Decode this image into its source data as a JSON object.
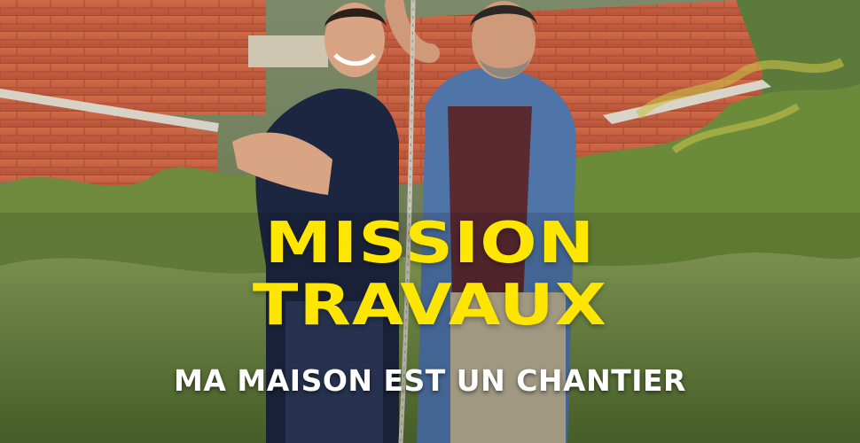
{
  "title": {
    "line1": "MISSION",
    "line2": "TRAVAUX"
  },
  "subtitle": "MA MAISON EST UN CHANTIER",
  "scene": {
    "description_icons": [
      "brick-wall",
      "measuring-tape",
      "grass"
    ]
  },
  "colors": {
    "title": "#ffe600",
    "subtitle": "#ffffff",
    "brick": "#c25a3e",
    "foliage": "#6b8a3a"
  }
}
